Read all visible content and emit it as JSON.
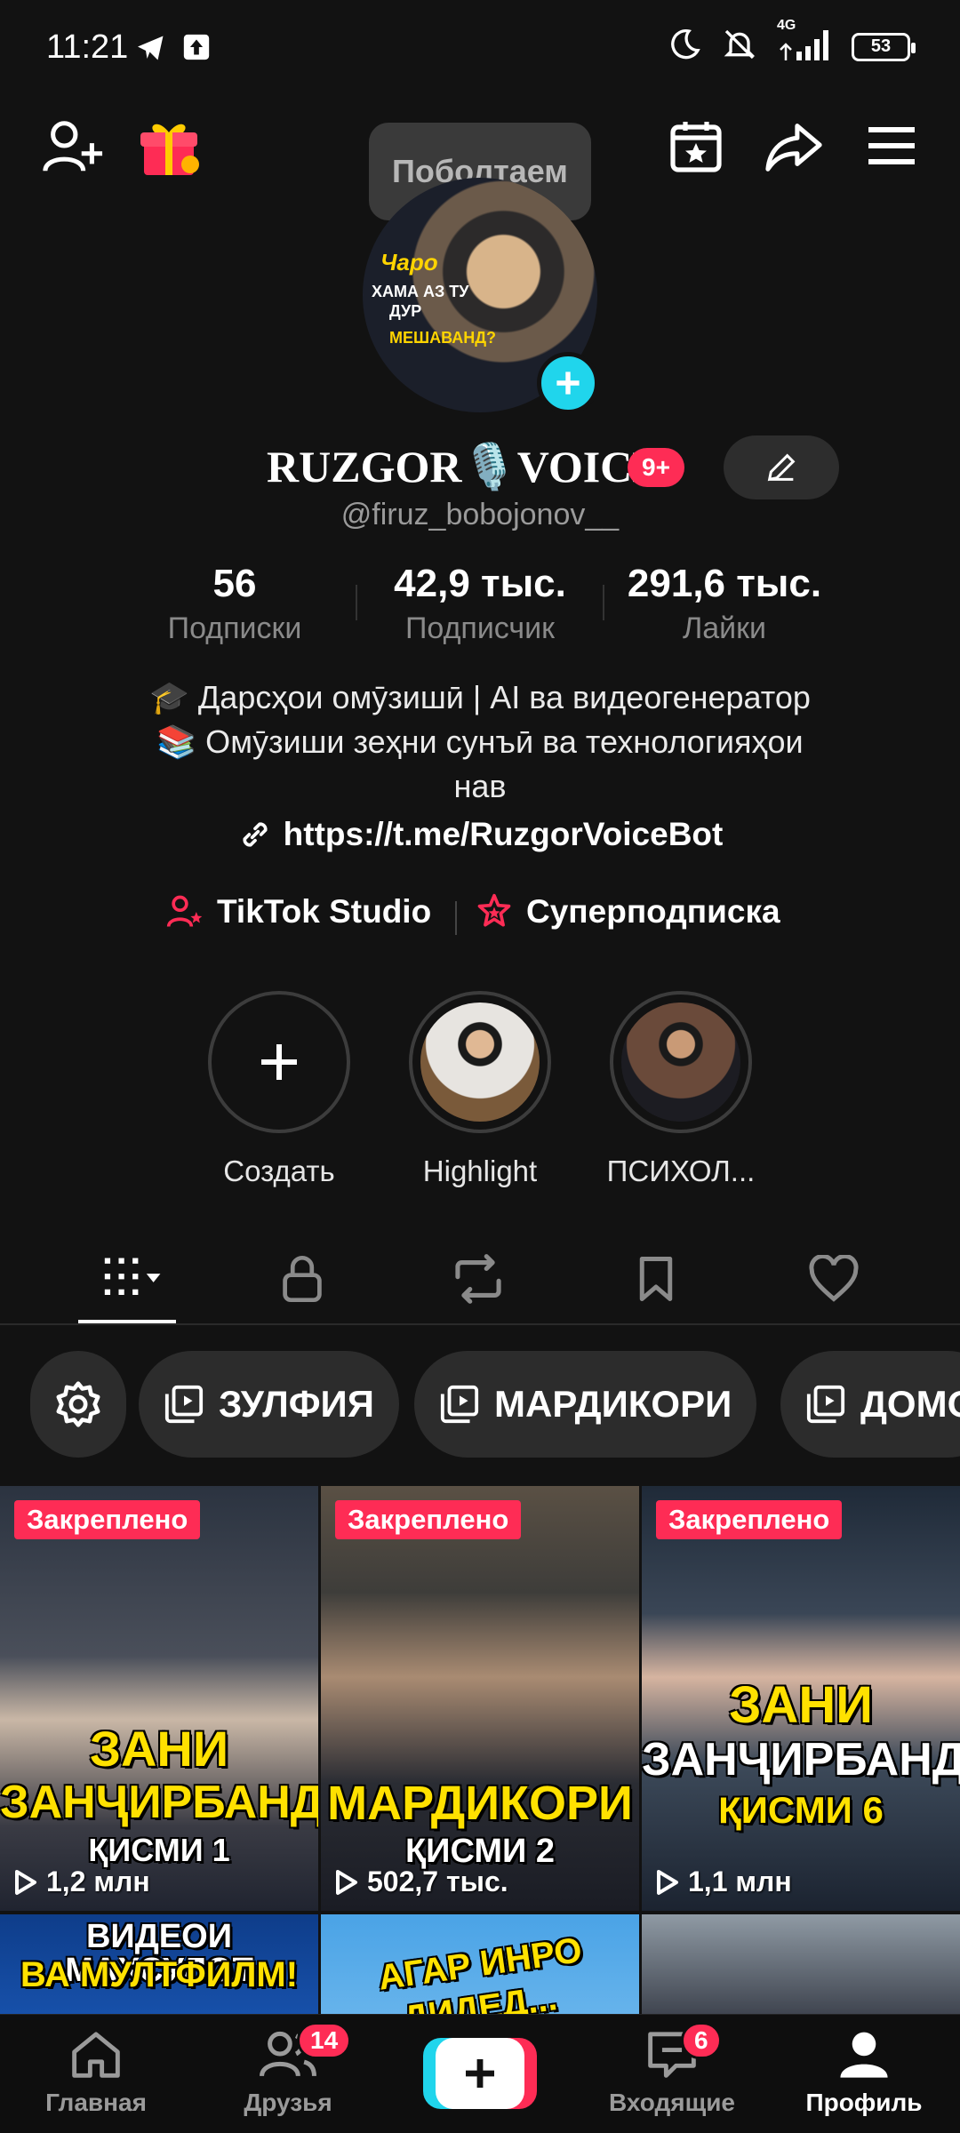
{
  "status_bar": {
    "time": "11:21",
    "network": "4G",
    "battery": "53"
  },
  "top_bar": {
    "tooltip": "Поболтаем"
  },
  "profile": {
    "avatar_text": [
      "Чаро",
      "ХАМА АЗ ТУ",
      "ДУР",
      "МЕШАВАНД?"
    ],
    "display_name": "RUZGOR🎙️VOICE",
    "notif_badge": "9+",
    "handle": "@firuz_bobojonov__",
    "stats": [
      {
        "value": "56",
        "label": "Подписки"
      },
      {
        "value": "42,9 тыс.",
        "label": "Подписчик"
      },
      {
        "value": "291,6 тыс.",
        "label": "Лайки"
      }
    ],
    "bio_line1": "🎓 Дарсҳои омӯзишӣ | AI ва видеогенератор",
    "bio_line2": "📚 Омӯзиши зеҳни сунъӣ ва технологияҳои",
    "bio_line3": "нав",
    "link": "https://t.me/RuzgorVoiceBot",
    "tiktok_studio": "TikTok Studio",
    "supersub": "Суперподписка"
  },
  "highlights": [
    {
      "label": "Создать"
    },
    {
      "label": "Highlight"
    },
    {
      "label": "ПСИХОЛ..."
    }
  ],
  "playlists": [
    "ЗУЛФИЯ",
    "МАРДИКОРИ",
    "ДОМО"
  ],
  "videos": [
    {
      "pinned": "Закреплено",
      "caption1": "ЗАНИ",
      "caption2": "ЗАНҶИРБАНД",
      "caption3": "ҚИСМИ 1",
      "views": "1,2 млн"
    },
    {
      "pinned": "Закреплено",
      "caption1": "МАРДИКОРИ",
      "caption2": "ҚИСМИ 2",
      "caption3": "",
      "views": "502,7 тыс."
    },
    {
      "pinned": "Закреплено",
      "caption1": "ЗАНИ",
      "caption2": "ЗАНҶИРБАНД",
      "caption3": "ҚИСМИ 6",
      "views": "1,1 млн"
    },
    {
      "caption1": "ВИДЕОИ МАХСУЛОТ",
      "caption2": "ВА МУЛТФИЛМ!"
    },
    {
      "caption1": "АГАР ИНРО",
      "caption2": "ДИДЕД..."
    },
    {
      "caption1": ""
    }
  ],
  "bottom_nav": {
    "home": "Главная",
    "friends": "Друзья",
    "friends_badge": "14",
    "inbox": "Входящие",
    "inbox_badge": "6",
    "profile": "Профиль"
  },
  "colors": {
    "background": "#121212",
    "accent_red": "#fe2c55",
    "accent_cyan": "#20d5ec"
  }
}
